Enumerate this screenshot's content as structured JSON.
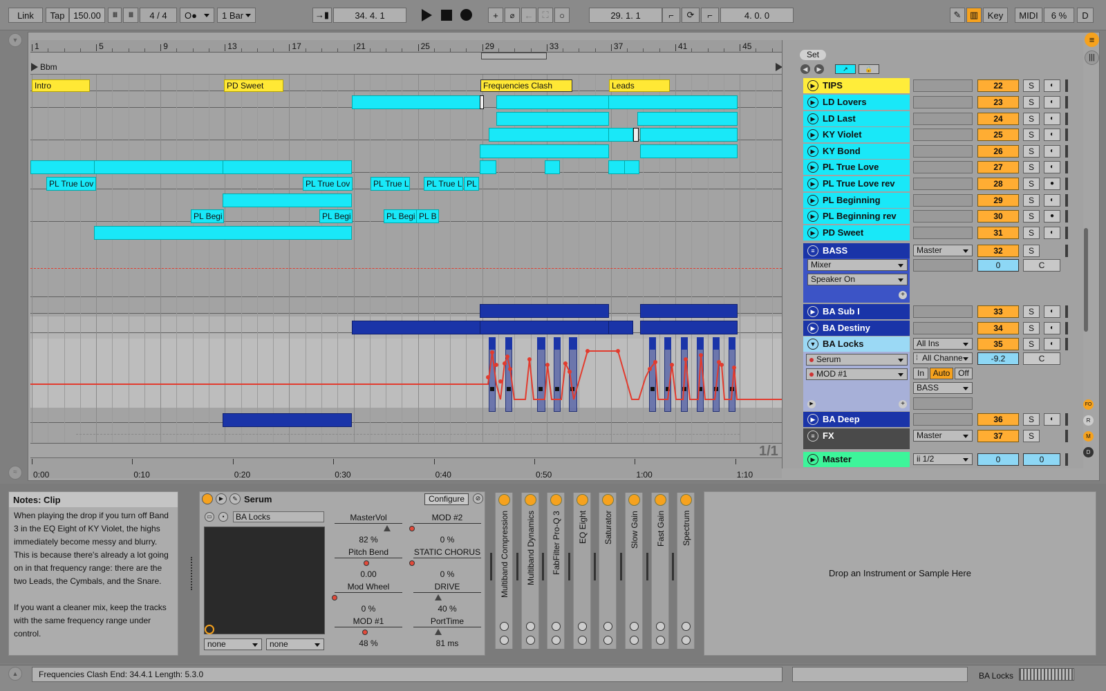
{
  "transport": {
    "link": "Link",
    "tap": "Tap",
    "tempo": "150.00",
    "signature": "4 / 4",
    "quantize": "1 Bar",
    "arrangement_position": "34.  4.  1",
    "loop_start": "29.  1.  1",
    "loop_length": "4.  0.  0",
    "key_label": "Key",
    "midi_label": "MIDI",
    "cpu": "6 %",
    "d_label": "D"
  },
  "ruler": {
    "bars": [
      "1",
      "5",
      "9",
      "13",
      "17",
      "21",
      "25",
      "29",
      "33",
      "37",
      "41",
      "45"
    ],
    "times": [
      "0:00",
      "0:10",
      "0:20",
      "0:30",
      "0:40",
      "0:50",
      "1:00",
      "1:10"
    ],
    "scale_label": "Bbm",
    "page_indicator": "1/1"
  },
  "locators": [
    "Intro",
    "PD Sweet",
    "Frequencies Clash",
    "Leads"
  ],
  "clip_labels": {
    "pl_true_love": "PL True Lov",
    "pl_true_love_2": "PL True Lov",
    "pl_true_love_3": "PL True L",
    "pl_true_love_4": "PL True L",
    "pl_true_love_5": "PL T",
    "pl_beginning": "PL Begi",
    "pl_beginning_2": "PL Begi",
    "pl_beginning_3": "PL Begi",
    "pl_beginning_4": "PL B"
  },
  "session": {
    "set_label": "Set"
  },
  "tracks": [
    {
      "name": "TIPS",
      "num": "22",
      "color": "#ffed3a"
    },
    {
      "name": "LD Lovers",
      "num": "23",
      "color": "#19e8f8"
    },
    {
      "name": "LD Last",
      "num": "24",
      "color": "#19e8f8"
    },
    {
      "name": "KY Violet",
      "num": "25",
      "color": "#19e8f8"
    },
    {
      "name": "KY Bond",
      "num": "26",
      "color": "#19e8f8"
    },
    {
      "name": "PL True Love",
      "num": "27",
      "color": "#19e8f8"
    },
    {
      "name": "PL True Love rev",
      "num": "28",
      "color": "#19e8f8"
    },
    {
      "name": "PL Beginning",
      "num": "29",
      "color": "#19e8f8"
    },
    {
      "name": "PL Beginning rev",
      "num": "30",
      "color": "#19e8f8"
    },
    {
      "name": "PD Sweet",
      "num": "31",
      "color": "#19e8f8"
    }
  ],
  "bass_group": {
    "name": "BASS",
    "num": "32",
    "routing": "Master",
    "chain1": "Mixer",
    "chain2": "Speaker On",
    "pan": "0",
    "pan_c": "C"
  },
  "bass_tracks": [
    {
      "name": "BA Sub I",
      "num": "33"
    },
    {
      "name": "BA Destiny",
      "num": "34"
    }
  ],
  "ba_locks": {
    "name": "BA Locks",
    "num": "35",
    "input": "All Ins",
    "channel": "All Channe",
    "device": "Serum",
    "param": "MOD #1",
    "monitor_in": "In",
    "monitor_auto": "Auto",
    "monitor_off": "Off",
    "output": "BASS",
    "volume": "-9.2",
    "pan_c": "C"
  },
  "ba_deep": {
    "name": "BA Deep",
    "num": "36"
  },
  "fx": {
    "name": "FX",
    "num": "37",
    "routing": "Master"
  },
  "master": {
    "name": "Master",
    "routing": "ii 1/2",
    "vol": "0",
    "vol2": "0"
  },
  "solo_label": "S",
  "side_buttons": {
    "fo": "FO",
    "r": "R",
    "m": "M",
    "d": "D"
  },
  "notes": {
    "title": "Notes: Clip",
    "p1": "When playing the drop if you turn off Band 3 in the EQ Eight of KY Violet, the highs immediately become messy and blurry.",
    "p2": "This is because there's already a lot going on in that frequency range: there are the two Leads, the Cymbals, and the Snare.",
    "p3": "If you want a cleaner mix, keep the tracks with the same frequency range under control."
  },
  "serum": {
    "title": "Serum",
    "configure": "Configure",
    "preset": "BA Locks",
    "macro_left": "none",
    "macro_right": "none",
    "params": [
      {
        "name": "MasterVol",
        "value": "82 %"
      },
      {
        "name": "MOD #2",
        "value": "0 %"
      },
      {
        "name": "Pitch Bend",
        "value": "0.00"
      },
      {
        "name": "STATIC CHORUS",
        "value": "0 %"
      },
      {
        "name": "Mod Wheel",
        "value": "0 %"
      },
      {
        "name": "DRIVE",
        "value": "40 %"
      },
      {
        "name": "MOD #1",
        "value": "48 %"
      },
      {
        "name": "PortTime",
        "value": "81 ms"
      }
    ]
  },
  "devices": [
    "Multiband Compression",
    "Multiband Dynamics",
    "FabFilter Pro-Q 3",
    "EQ Eight",
    "Saturator",
    "Slow Gain",
    "Fast Gain",
    "Spectrum"
  ],
  "drop_zone": "Drop an Instrument or Sample Here",
  "status": {
    "text": "Frequencies Clash  End: 34.4.1  Length: 5.3.0",
    "track": "BA Locks"
  }
}
